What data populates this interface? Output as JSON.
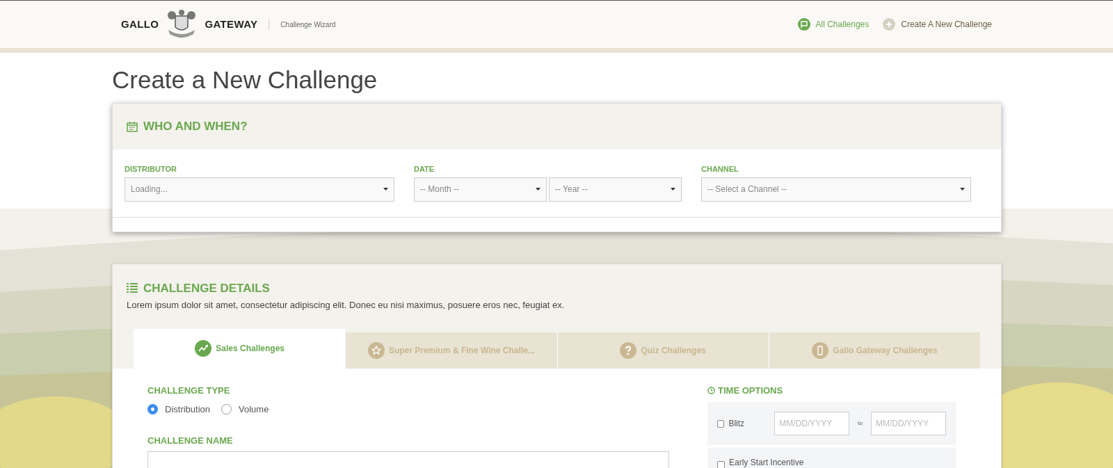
{
  "header": {
    "brand_left": "GALLO",
    "brand_right": "GATEWAY",
    "subtitle": "Challenge Wizard",
    "nav": [
      {
        "label": "All Challenges",
        "selected": true
      },
      {
        "label": "Create A New Challenge",
        "selected": false
      }
    ]
  },
  "page_title": "Create a New Challenge",
  "who_and_when": {
    "title": "WHO AND WHEN?",
    "fields": [
      {
        "label": "DISTRIBUTOR",
        "selects": [
          "Loading..."
        ]
      },
      {
        "label": "DATE",
        "selects": [
          "-- Month --",
          "-- Year --"
        ]
      },
      {
        "label": "CHANNEL",
        "selects": [
          "-- Select a Channel --"
        ]
      }
    ]
  },
  "challenge_details": {
    "title": "CHALLENGE DETAILS",
    "description": "Lorem ipsum dolor sit amet, consectetur adipiscing elit. Donec eu nisi maximus, posuere eros nec, feugiat ex.",
    "tabs": [
      {
        "label": "Sales Challenges",
        "selected": true,
        "kind": "chart"
      },
      {
        "label": "Super Premium & Fine Wine Challe...",
        "selected": false,
        "kind": "star"
      },
      {
        "label": "Quiz Challenges",
        "selected": false,
        "kind": "question"
      },
      {
        "label": "Gallo Gateway Challenges",
        "selected": false,
        "kind": "phone"
      }
    ],
    "challenge_type": {
      "label": "CHALLENGE TYPE",
      "options": [
        {
          "label": "Distribution",
          "selected": true
        },
        {
          "label": "Volume",
          "selected": false
        }
      ]
    },
    "challenge_name": {
      "label": "CHALLENGE NAME"
    },
    "time_options": {
      "title": "TIME OPTIONS",
      "rows": [
        {
          "label": "Blitz",
          "checked": false,
          "kind": "range",
          "from_placeholder": "MM/DD/YYYY",
          "separator": "to",
          "to_placeholder": "MM/DD/YYYY"
        },
        {
          "label": "Early Start Incentive",
          "checked": false,
          "kind": "plain"
        }
      ]
    }
  }
}
